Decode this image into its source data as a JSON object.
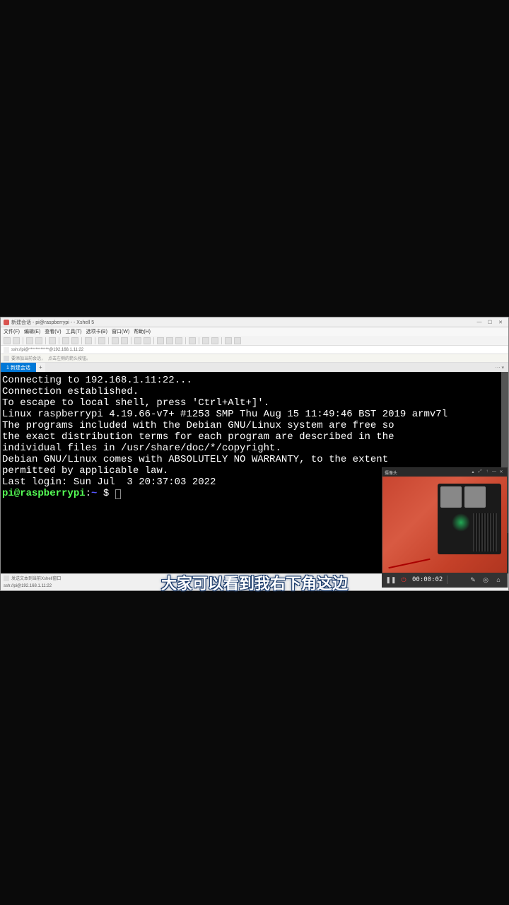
{
  "window": {
    "title": "新建会话 - pi@raspberrypi - - Xshell 5"
  },
  "menu": {
    "file": "文件(F)",
    "edit": "编辑(E)",
    "view": "查看(V)",
    "tools": "工具(T)",
    "tabs": "选项卡(B)",
    "window": "窗口(W)",
    "help": "帮助(H)"
  },
  "addressbar": {
    "text": "ssh://pi@************@192.168.1.11:22"
  },
  "hintbar": {
    "text1": "要添加当前会话，",
    "text2": "点击左侧的箭头按钮。"
  },
  "tab": {
    "label": "1 新建会话",
    "add": "+"
  },
  "terminal": {
    "lines": [
      "Connecting to 192.168.1.11:22...",
      "",
      "Connection established.",
      "To escape to local shell, press 'Ctrl+Alt+]'.",
      "",
      "Linux raspberrypi 4.19.66-v7+ #1253 SMP Thu Aug 15 11:49:46 BST 2019 armv7l",
      "",
      "The programs included with the Debian GNU/Linux system are free so",
      "the exact distribution terms for each program are described in the",
      "individual files in /usr/share/doc/*/copyright.",
      "",
      "Debian GNU/Linux comes with ABSOLUTELY NO WARRANTY, to the extent",
      "permitted by applicable law.",
      "Last login: Sun Jul  3 20:37:03 2022"
    ],
    "prompt_user": "pi@raspberrypi",
    "prompt_colon": ":",
    "prompt_tilde": "~",
    "prompt_dollar": " $ "
  },
  "statusbar": {
    "top": "发送文本到当前Xshell窗口",
    "bottom_left": "ssh://pi@192.168.1.11:22"
  },
  "camera": {
    "title": "摄像头",
    "time": "00:00:02"
  },
  "subtitle": {
    "text": "大家可以看到我右下角这边"
  }
}
